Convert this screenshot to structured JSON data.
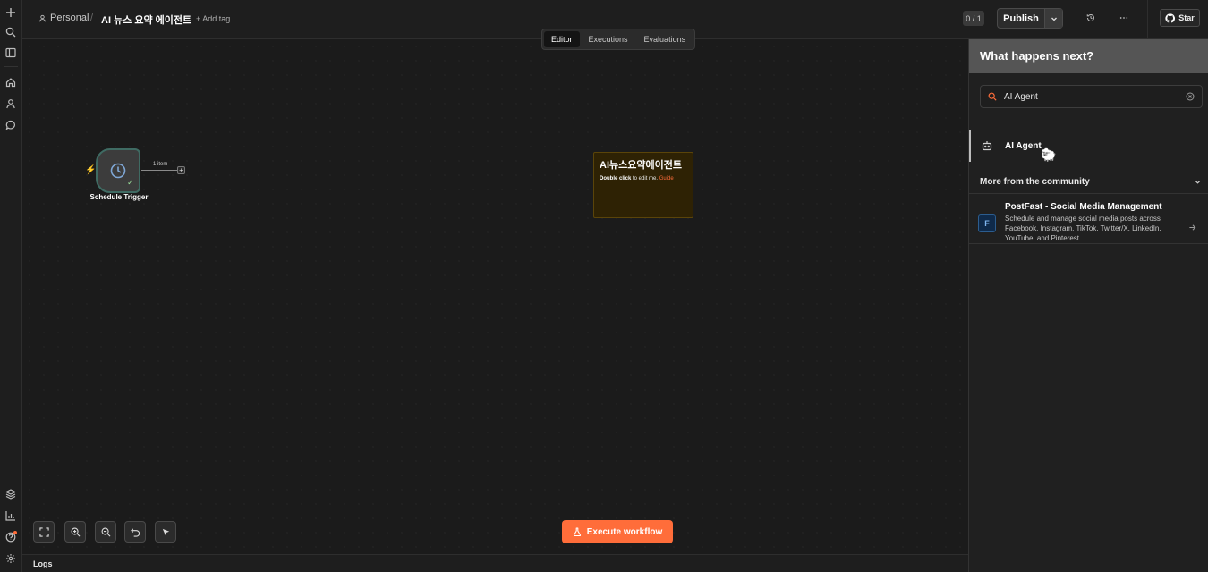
{
  "breadcrumb": {
    "project": "Personal",
    "separator": "/",
    "workflow_name": "AI 뉴스 요약 에이전트",
    "add_tag": "+ Add tag"
  },
  "toolbar": {
    "counter": "0 / 1",
    "publish_label": "Publish",
    "github_star": "Star"
  },
  "view_tabs": [
    {
      "label": "Editor",
      "active": true
    },
    {
      "label": "Executions",
      "active": false
    },
    {
      "label": "Evaluations",
      "active": false
    }
  ],
  "canvas": {
    "trigger_node_label": "Schedule Trigger",
    "connection_label": "1 item",
    "sticky_note": {
      "title": "AI뉴스요약에이전트",
      "text_bold": "Double click",
      "text_rest": " to edit me. ",
      "link": "Guide"
    },
    "execute_label": "Execute workflow"
  },
  "logs_label": "Logs",
  "panel": {
    "title": "What happens next?",
    "search_value": "AI Agent",
    "result_label": "AI Agent",
    "section_title": "More from the community",
    "community": {
      "logo": "F",
      "title": "PostFast - Social Media Management",
      "description": "Schedule and manage social media posts across Facebook, Instagram, TikTok, Twitter/X, LinkedIn, YouTube, and Pinterest"
    }
  },
  "colors": {
    "accent": "#ff6d3a",
    "canvas_bg": "#1b1b1b",
    "panel_header": "#555555"
  }
}
